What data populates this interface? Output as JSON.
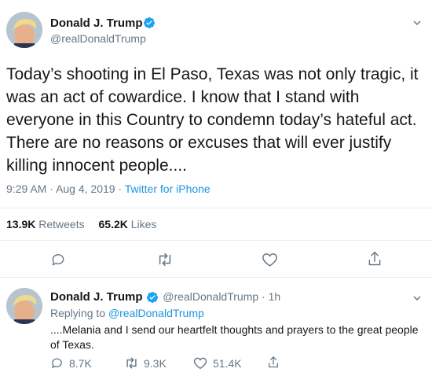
{
  "main_tweet": {
    "display_name": "Donald J. Trump",
    "handle": "@realDonaldTrump",
    "text": "Today’s shooting in El Paso, Texas was not only tragic, it was an act of cowardice. I know that I stand with everyone in this Country to condemn today’s hateful act. There are no reasons or excuses that will ever justify killing innocent people....",
    "time": "9:29 AM",
    "date": "Aug 4, 2019",
    "separator": "·",
    "source": "Twitter for iPhone",
    "retweets_count": "13.9K",
    "retweets_label": "Retweets",
    "likes_count": "65.2K",
    "likes_label": "Likes",
    "actions": {
      "reply_icon": "reply-icon",
      "retweet_icon": "retweet-icon",
      "like_icon": "heart-icon",
      "share_icon": "share-icon"
    }
  },
  "reply_tweet": {
    "display_name": "Donald J. Trump",
    "handle": "@realDonaldTrump",
    "separator": "·",
    "age": "1h",
    "replying_prefix": "Replying to",
    "replying_to": "@realDonaldTrump",
    "text": "....Melania and I send our heartfelt thoughts and prayers to the great people of Texas.",
    "reply_count": "8.7K",
    "retweet_count": "9.3K",
    "like_count": "51.4K"
  },
  "colors": {
    "link": "#1b95e0",
    "muted": "#657786",
    "verified": "#1da1f2",
    "divider": "#e6ecf0"
  }
}
